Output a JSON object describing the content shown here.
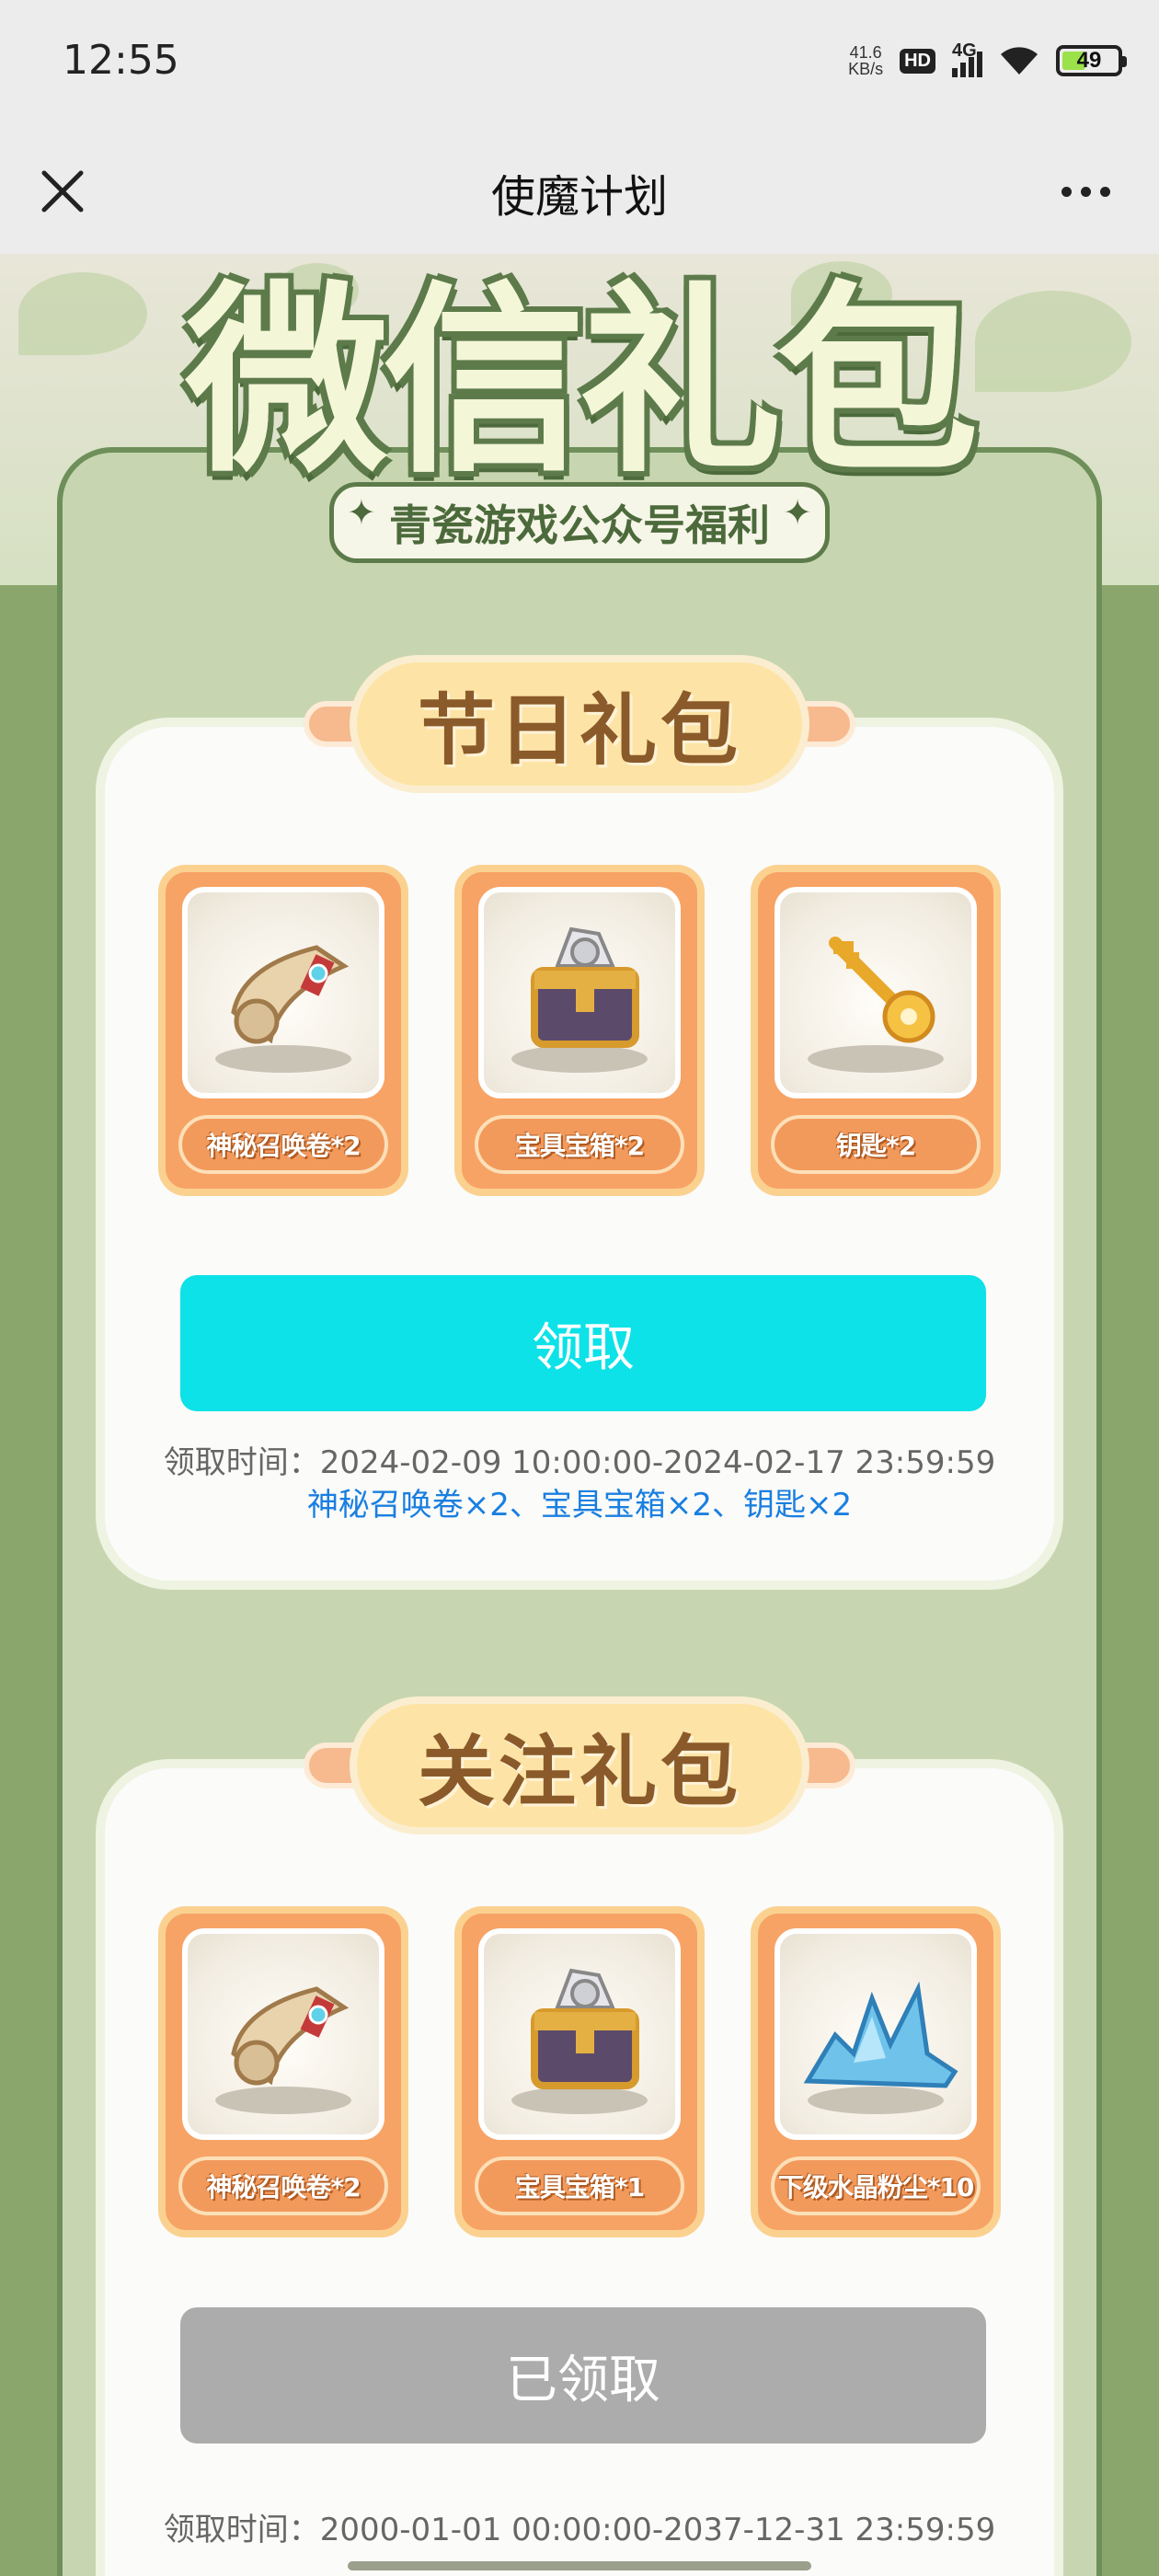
{
  "status_bar": {
    "time": "12:55",
    "net_speed_value": "41.6",
    "net_speed_unit": "KB/s",
    "hd_badge": "HD",
    "network": "4G",
    "battery": "49",
    "battery_level_percent": 49
  },
  "navbar": {
    "title": "使魔计划",
    "close_icon": "close-icon",
    "more_icon": "more-icon"
  },
  "banner": {
    "title": "微信礼包",
    "subtitle": "青瓷游戏公众号福利"
  },
  "packs": [
    {
      "heading": "节日礼包",
      "items": [
        {
          "label": "神秘召唤卷*2",
          "icon": "scroll-icon"
        },
        {
          "label": "宝具宝箱*2",
          "icon": "treasure-chest-icon"
        },
        {
          "label": "钥匙*2",
          "icon": "key-icon"
        }
      ],
      "button": "领取",
      "claim_time": "领取时间：2024-02-09 10:00:00-2024-02-17 23:59:59",
      "rewards": "神秘召唤卷×2、宝具宝箱×2、钥匙×2"
    },
    {
      "heading": "关注礼包",
      "items": [
        {
          "label": "神秘召唤卷*2",
          "icon": "scroll-icon"
        },
        {
          "label": "宝具宝箱*1",
          "icon": "treasure-chest-icon"
        },
        {
          "label": "下级水晶粉尘*10",
          "icon": "crystal-dust-icon"
        }
      ],
      "button": "已领取",
      "claim_time": "领取时间：2000-01-01 00:00:00-2037-12-31 23:59:59"
    }
  ],
  "colors": {
    "claim_active": "#0ce2e8",
    "claim_done": "#acacac",
    "reward_text": "#1a7fe0"
  }
}
